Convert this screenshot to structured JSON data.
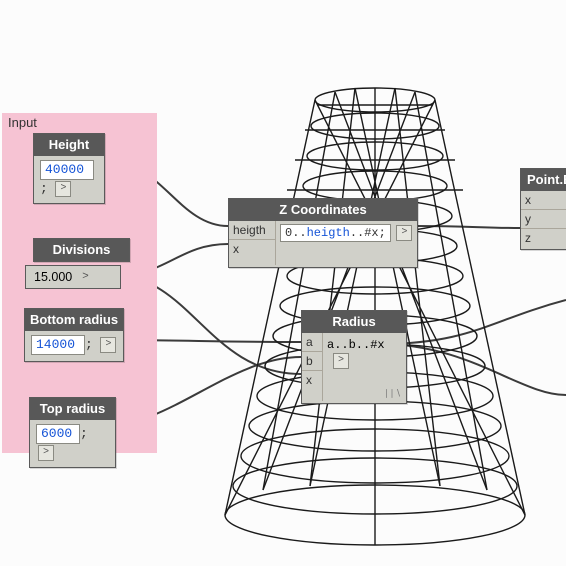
{
  "group": {
    "title": "Input"
  },
  "nodes": {
    "height": {
      "title": "Height",
      "value": "40000",
      "suffix": ";",
      "chevron": ">"
    },
    "divisions": {
      "title": "Divisions",
      "value": "15.000",
      "chevron": ">"
    },
    "bottomR": {
      "title": "Bottom radius",
      "value": "14000",
      "suffix": ";",
      "chevron": ">"
    },
    "topR": {
      "title": "Top radius",
      "value": "6000",
      "suffix": ";",
      "chevron": ">"
    },
    "zcoord": {
      "title": "Z Coordinates",
      "ports": [
        "heigth",
        "x"
      ],
      "code_prefix": "0..",
      "code_var": "heigth",
      "code_suffix": "..#x;",
      "chevron": ">"
    },
    "radius": {
      "title": "Radius",
      "ports": [
        "a",
        "b",
        "x"
      ],
      "code": "a..b..#x",
      "chevron": ">"
    },
    "point": {
      "title": "Point.By",
      "ports": [
        "x",
        "y",
        "z"
      ]
    }
  }
}
